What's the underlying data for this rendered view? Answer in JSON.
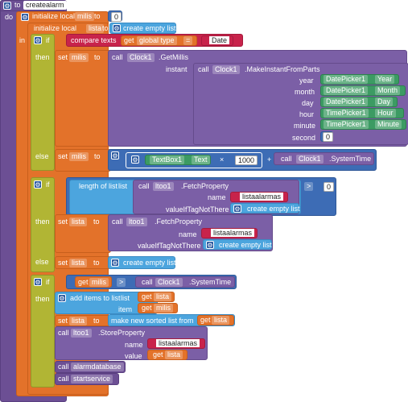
{
  "keywords": {
    "to": "to",
    "do": "do",
    "in": "in",
    "if": "if",
    "then": "then",
    "else": "else",
    "call": "call",
    "get": "get",
    "set": "set",
    "name": "name",
    "instant": "instant",
    "item": "item",
    "value": "value",
    "list": "list"
  },
  "procedure": {
    "name": "createalarm"
  },
  "init": [
    {
      "label": "initialize local",
      "var": "milis",
      "value": "0"
    },
    {
      "label": "initialize local",
      "var": "lista",
      "value": "create empty list"
    }
  ],
  "if1": {
    "compare_label": "compare texts",
    "get_var": "global type",
    "op": "=",
    "literal": "Date",
    "set_var": "milis",
    "clock": "Clock1",
    "get_millis": ".GetMillis",
    "make_instant": ".MakeInstantFromParts",
    "params": [
      {
        "label": "year",
        "picker": "DatePicker1",
        "prop": "Year"
      },
      {
        "label": "month",
        "picker": "DatePicker1",
        "prop": "Month"
      },
      {
        "label": "day",
        "picker": "DatePicker1",
        "prop": "Day"
      },
      {
        "label": "hour",
        "picker": "TimePicker1",
        "prop": "Hour"
      },
      {
        "label": "minute",
        "picker": "TimePicker1",
        "prop": "Minute"
      },
      {
        "label": "second",
        "value": "0"
      }
    ],
    "else_textbox": "TextBox1",
    "else_text_prop": "Text",
    "mult1": "×",
    "mult_value": "1000",
    "plus": "+",
    "system_time": ".SystemTime"
  },
  "if2": {
    "length_label": "length of list",
    "tinydb": "ltoo1",
    "fetch": ".FetchProperty",
    "tag": "listaalarmas",
    "value_if_label": "valueIfTagNotThere",
    "empty": "create empty list",
    "op": ">",
    "compare_value": "0",
    "set_var": "lista",
    "else_empty": "create empty list"
  },
  "if3": {
    "get_var": "milis",
    "op": ">",
    "clock": "Clock1",
    "system_time": ".SystemTime",
    "add_items": "add items to list",
    "list_var": "lista",
    "item_var": "milis",
    "sorted_label": "make new sorted list from",
    "sorted_var": "lista",
    "store": ".StoreProperty",
    "store_tag": "listaalarmas",
    "store_value": "lista",
    "call1": "alarmdatabase",
    "call2": "startservice"
  }
}
